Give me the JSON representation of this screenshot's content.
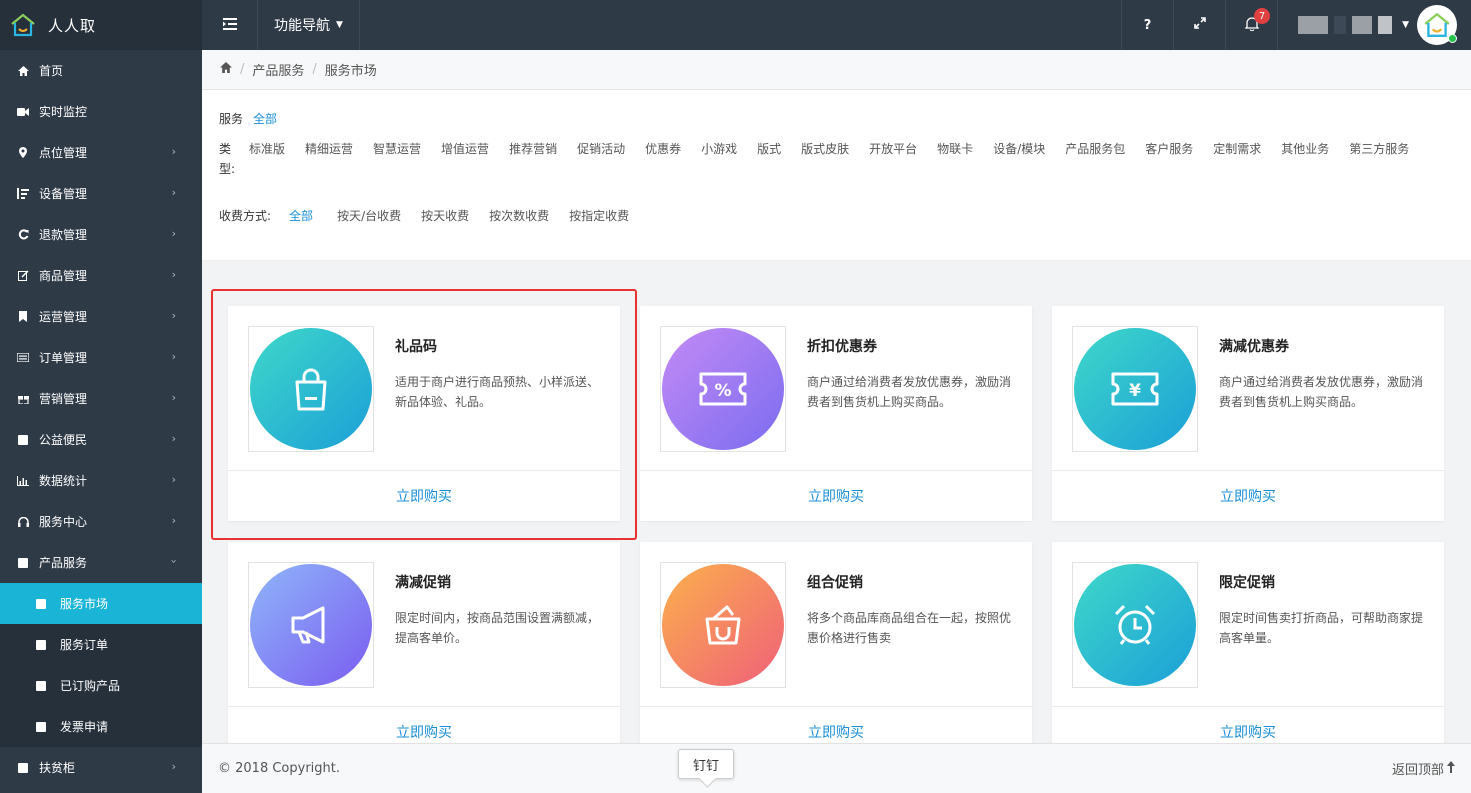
{
  "app": {
    "name": "人人取"
  },
  "topbar": {
    "nav_label": "功能导航",
    "help": "?",
    "notif_count": "7"
  },
  "sidebar": {
    "items": [
      {
        "label": "首页",
        "icon": "home-icon"
      },
      {
        "label": "实时监控",
        "icon": "video-camera-icon"
      },
      {
        "label": "点位管理",
        "icon": "map-pin-icon"
      },
      {
        "label": "设备管理",
        "icon": "sort-icon"
      },
      {
        "label": "退款管理",
        "icon": "refresh-icon"
      },
      {
        "label": "商品管理",
        "icon": "edit-icon"
      },
      {
        "label": "运营管理",
        "icon": "bookmark-icon"
      },
      {
        "label": "订单管理",
        "icon": "list-icon"
      },
      {
        "label": "营销管理",
        "icon": "gift-icon"
      },
      {
        "label": "公益便民",
        "icon": "square-icon"
      },
      {
        "label": "数据统计",
        "icon": "bar-chart-icon"
      },
      {
        "label": "服务中心",
        "icon": "headset-icon"
      },
      {
        "label": "产品服务",
        "icon": "square-icon"
      }
    ],
    "sub_items": [
      {
        "label": "服务市场",
        "active": true
      },
      {
        "label": "服务订单"
      },
      {
        "label": "已订购产品"
      },
      {
        "label": "发票申请"
      }
    ],
    "last_item": {
      "label": "扶贫柜",
      "icon": "square-icon"
    }
  },
  "breadcrumb": {
    "level1": "产品服务",
    "level2": "服务市场"
  },
  "filter": {
    "service_label": "服务",
    "service_all": "全部",
    "type_label": "类型:",
    "types": [
      "标准版",
      "精细运营",
      "智慧运营",
      "增值运营",
      "推荐营销",
      "促销活动",
      "优惠券",
      "小游戏",
      "版式",
      "版式皮肤",
      "开放平台",
      "物联卡",
      "设备/模块",
      "产品服务包",
      "客户服务",
      "定制需求",
      "其他业务",
      "第三方服务"
    ],
    "fee_label": "收费方式:",
    "fees": [
      "全部",
      "按天/台收费",
      "按天收费",
      "按次数收费",
      "按指定收费"
    ]
  },
  "cards": [
    {
      "title": "礼品码",
      "desc": "适用于商户进行商品预热、小样派送、新品体验、礼品。",
      "action": "立即购买",
      "icon": "shopping-bag-icon",
      "color_a": "#3fd8c9",
      "color_b": "#1b9fd8"
    },
    {
      "title": "折扣优惠券",
      "desc": "商户通过给消费者发放优惠券，激励消费者到售货机上购买商品。",
      "action": "立即购买",
      "icon": "percent-ticket-icon",
      "color_a": "#c48bf5",
      "color_b": "#7b6cf0"
    },
    {
      "title": "满减优惠券",
      "desc": "商户通过给消费者发放优惠券，激励消费者到售货机上购买商品。",
      "action": "立即购买",
      "icon": "yen-ticket-icon",
      "color_a": "#3fd8c9",
      "color_b": "#1b9fd8"
    },
    {
      "title": "满减促销",
      "desc": "限定时间内，按商品范围设置满额减，提高客单价。",
      "action": "立即购买",
      "icon": "megaphone-icon",
      "color_a": "#8fb6fa",
      "color_b": "#7a5cf0"
    },
    {
      "title": "组合促销",
      "desc": "将多个商品库商品组合在一起，按照优惠价格进行售卖",
      "action": "立即购买",
      "icon": "basket-icon",
      "color_a": "#fbb04c",
      "color_b": "#f0607a"
    },
    {
      "title": "限定促销",
      "desc": "限定时间售卖打折商品，可帮助商家提高客单量。",
      "action": "立即购买",
      "icon": "alarm-clock-icon",
      "color_a": "#3fd8c9",
      "color_b": "#1b9fd8"
    }
  ],
  "footer": {
    "copyright": "© 2018 Copyright.",
    "back_top": "返回顶部"
  },
  "tooltip": {
    "text": "钉钉"
  }
}
